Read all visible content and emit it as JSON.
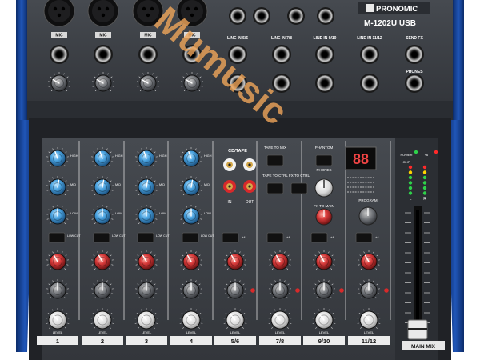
{
  "brand": {
    "name": "PRONOMIC",
    "model": "M-1202U USB"
  },
  "top_labels": {
    "mic": [
      "MIC",
      "MIC",
      "MIC",
      "MIC"
    ],
    "line_in": [
      "LINE IN 5/6",
      "LINE IN 7/8",
      "LINE IN 9/10",
      "LINE IN 11/12"
    ],
    "send_fx": "SEND FX",
    "phones": "PHONES"
  },
  "master": {
    "cd_tape": "CD/TAPE",
    "in_label": "IN",
    "out_label": "OUT",
    "tape_to_mix": "TAPE TO MIX",
    "tape_to_ctrl": "TAPE TO CTRL",
    "fx_to_ctrl": "FX TO CTRL",
    "phantom": "PHANTOM",
    "phones": "PHONES",
    "fx_to_main": "FX TO MAIN",
    "program": "PROGRAM",
    "display": "88",
    "meter_labels": [
      "POWER",
      "+6",
      "CLIP",
      "L",
      "R"
    ]
  },
  "eq": {
    "hi": "HIGH",
    "mid": "MID",
    "low": "LOW",
    "low_cut": "LOW CUT",
    "level": "LEVEL"
  },
  "channels": [
    "1",
    "2",
    "3",
    "4",
    "5/6",
    "7/8",
    "9/10",
    "11/12"
  ],
  "main_mix": "MAIN MIX",
  "watermark": "Mumusic",
  "colors": {
    "panel": "#3b3f45",
    "frame": "#1b1d21",
    "blue_knob": "#4aa3e0",
    "red_knob": "#d83a3a",
    "led_green": "#2ed24a",
    "led_red": "#ff2a2a",
    "led_yellow": "#ffd400",
    "watermark": "#f0a65a"
  }
}
